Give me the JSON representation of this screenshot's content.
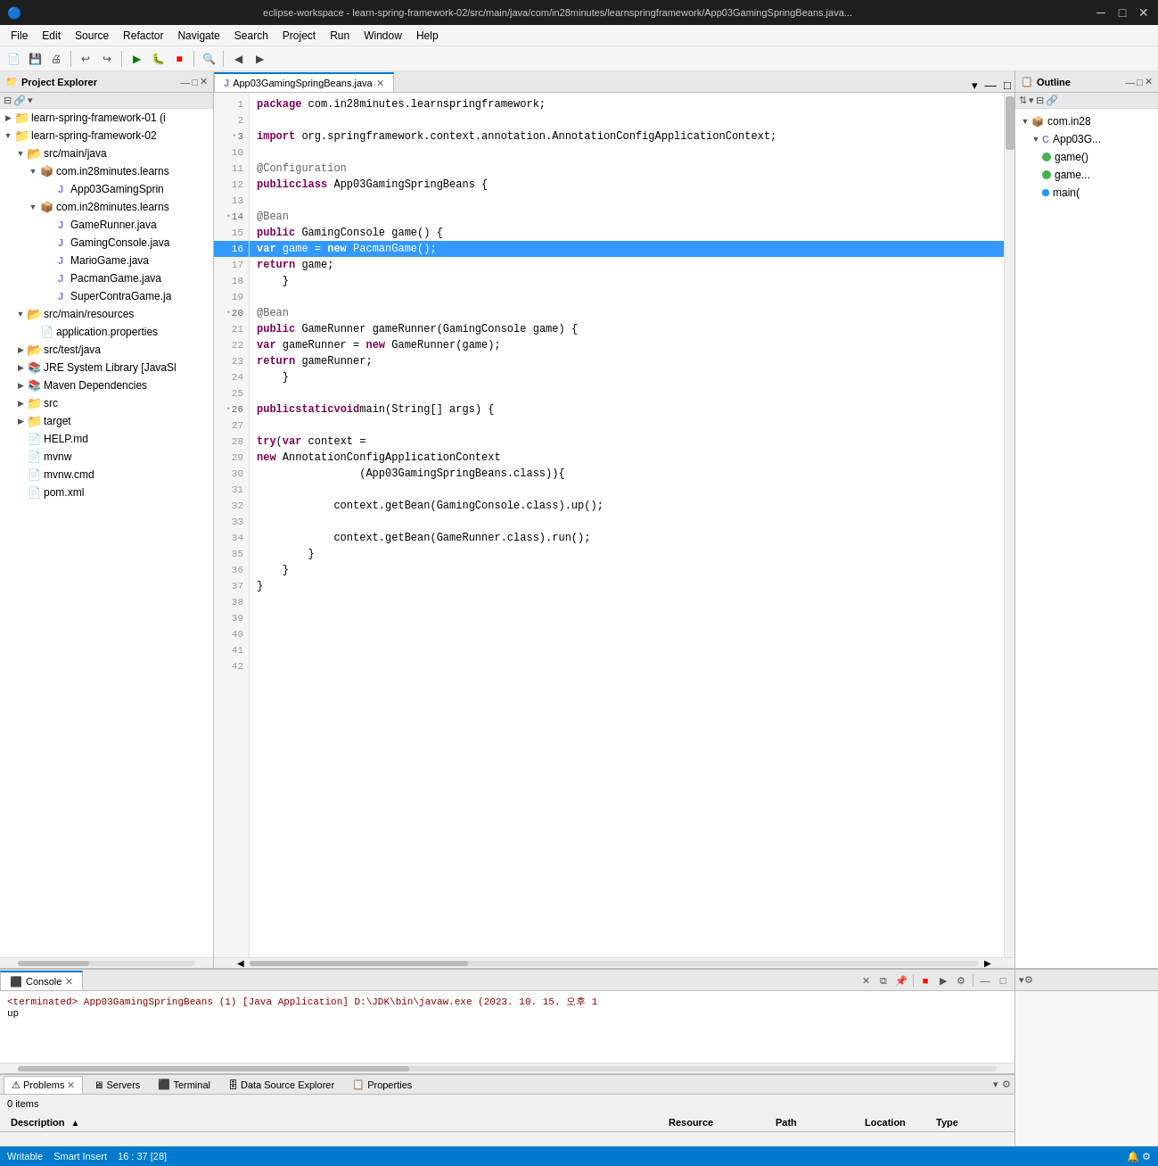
{
  "window": {
    "title": "eclipse-workspace - learn-spring-framework-02/src/main/java/com/in28minutes/learnspringframework/App03GamingSpringBeans.java...",
    "icon": "eclipse-icon"
  },
  "menu": {
    "items": [
      "File",
      "Edit",
      "Source",
      "Refactor",
      "Navigate",
      "Search",
      "Project",
      "Run",
      "Window",
      "Help"
    ]
  },
  "project_explorer": {
    "title": "Project Explorer",
    "items": [
      {
        "label": "learn-spring-framework-01 (i",
        "level": 0,
        "type": "project",
        "expanded": true
      },
      {
        "label": "learn-spring-framework-02",
        "level": 0,
        "type": "project",
        "expanded": true
      },
      {
        "label": "src/main/java",
        "level": 1,
        "type": "src-folder",
        "expanded": true
      },
      {
        "label": "com.in28minutes.learns",
        "level": 2,
        "type": "package",
        "expanded": true
      },
      {
        "label": "App03GamingSprin",
        "level": 3,
        "type": "java",
        "expanded": false
      },
      {
        "label": "com.in28minutes.learns",
        "level": 2,
        "type": "package",
        "expanded": true
      },
      {
        "label": "GameRunner.java",
        "level": 3,
        "type": "java",
        "expanded": false
      },
      {
        "label": "GamingConsole.java",
        "level": 3,
        "type": "java",
        "expanded": false
      },
      {
        "label": "MarioGame.java",
        "level": 3,
        "type": "java",
        "expanded": false
      },
      {
        "label": "PacmanGame.java",
        "level": 3,
        "type": "java",
        "expanded": false
      },
      {
        "label": "SuperContraGame.ja",
        "level": 3,
        "type": "java",
        "expanded": false
      },
      {
        "label": "src/main/resources",
        "level": 1,
        "type": "src-folder",
        "expanded": true
      },
      {
        "label": "application.properties",
        "level": 2,
        "type": "file",
        "expanded": false
      },
      {
        "label": "src/test/java",
        "level": 1,
        "type": "src-folder",
        "expanded": false
      },
      {
        "label": "JRE System Library [JavaSI",
        "level": 1,
        "type": "lib",
        "expanded": false
      },
      {
        "label": "Maven Dependencies",
        "level": 1,
        "type": "lib",
        "expanded": false
      },
      {
        "label": "src",
        "level": 1,
        "type": "folder",
        "expanded": false
      },
      {
        "label": "target",
        "level": 1,
        "type": "folder",
        "expanded": false
      },
      {
        "label": "HELP.md",
        "level": 1,
        "type": "file",
        "expanded": false
      },
      {
        "label": "mvnw",
        "level": 1,
        "type": "file",
        "expanded": false
      },
      {
        "label": "mvnw.cmd",
        "level": 1,
        "type": "file",
        "expanded": false
      },
      {
        "label": "pom.xml",
        "level": 1,
        "type": "file",
        "expanded": false
      }
    ]
  },
  "editor": {
    "tab": "App03GamingSpringBeans.java",
    "lines": [
      {
        "num": 1,
        "marker": "",
        "content": "<span class='kw'>package</span> com.in28minutes.learnspringframework;"
      },
      {
        "num": 2,
        "marker": "",
        "content": ""
      },
      {
        "num": 3,
        "marker": "•",
        "content": "<span class='kw'>import</span> org.springframework.context.annotation.AnnotationConfigApplicationContext;"
      },
      {
        "num": 10,
        "marker": "",
        "content": ""
      },
      {
        "num": 11,
        "marker": "",
        "content": "<span class='annotation'>@Configuration</span>"
      },
      {
        "num": 12,
        "marker": "",
        "content": "<span class='kw'>public</span> <span class='kw'>class</span> App03GamingSpringBeans {"
      },
      {
        "num": 13,
        "marker": "",
        "content": ""
      },
      {
        "num": 14,
        "marker": "•",
        "content": "    <span class='annotation'>@Bean</span>"
      },
      {
        "num": 15,
        "marker": "",
        "content": "    <span class='kw'>public</span> GamingConsole game() {"
      },
      {
        "num": 16,
        "marker": "",
        "content": "        <span class='kw'>var</span> game = <span class='kw'>new</span> PacmanGame();",
        "highlighted": true
      },
      {
        "num": 17,
        "marker": "",
        "content": "        <span class='kw'>return</span> game;"
      },
      {
        "num": 18,
        "marker": "",
        "content": "    }"
      },
      {
        "num": 19,
        "marker": "",
        "content": ""
      },
      {
        "num": 20,
        "marker": "•",
        "content": "    <span class='annotation'>@Bean</span>"
      },
      {
        "num": 21,
        "marker": "",
        "content": "    <span class='kw'>public</span> GameRunner gameRunner(GamingConsole game) {"
      },
      {
        "num": 22,
        "marker": "",
        "content": "        <span class='kw'>var</span> gameRunner = <span class='kw'>new</span> GameRunner(game);"
      },
      {
        "num": 23,
        "marker": "",
        "content": "        <span class='kw'>return</span> gameRunner;"
      },
      {
        "num": 24,
        "marker": "",
        "content": "    }"
      },
      {
        "num": 25,
        "marker": "",
        "content": ""
      },
      {
        "num": 26,
        "marker": "•",
        "content": "    <span class='kw'>public</span> <span class='kw'>static</span> <span class='kw'>void</span> main(String[] args) {"
      },
      {
        "num": 27,
        "marker": "",
        "content": ""
      },
      {
        "num": 28,
        "marker": "",
        "content": "        <span class='kw'>try</span>(<span class='kw'>var</span> context ="
      },
      {
        "num": 29,
        "marker": "",
        "content": "                <span class='kw'>new</span> AnnotationConfigApplicationContext"
      },
      {
        "num": 30,
        "marker": "",
        "content": "                (App03GamingSpringBeans.class)){"
      },
      {
        "num": 31,
        "marker": "",
        "content": ""
      },
      {
        "num": 32,
        "marker": "",
        "content": "            context.getBean(GamingConsole.class).up();"
      },
      {
        "num": 33,
        "marker": "",
        "content": ""
      },
      {
        "num": 34,
        "marker": "",
        "content": "            context.getBean(GameRunner.class).run();"
      },
      {
        "num": 35,
        "marker": "",
        "content": "        }"
      },
      {
        "num": 36,
        "marker": "",
        "content": "    }"
      },
      {
        "num": 37,
        "marker": "",
        "content": "}"
      },
      {
        "num": 38,
        "marker": "",
        "content": ""
      },
      {
        "num": 39,
        "marker": "",
        "content": ""
      },
      {
        "num": 40,
        "marker": "",
        "content": ""
      },
      {
        "num": 41,
        "marker": "",
        "content": ""
      },
      {
        "num": 42,
        "marker": "",
        "content": ""
      }
    ]
  },
  "outline": {
    "title": "Outline",
    "items": [
      {
        "label": "com.in28",
        "level": 0,
        "type": "package"
      },
      {
        "label": "App03G...",
        "level": 1,
        "type": "class"
      },
      {
        "label": "game()",
        "level": 2,
        "type": "method-green"
      },
      {
        "label": "game...",
        "level": 2,
        "type": "method-green"
      },
      {
        "label": "main(",
        "level": 2,
        "type": "method-blue"
      }
    ]
  },
  "console": {
    "title": "Console",
    "content": "<terminated> App03GamingSpringBeans (1) [Java Application] D:\\JDK\\bin\\javaw.exe  (2023. 10. 15. 오후 1",
    "content2": "up"
  },
  "bottom_tabs": {
    "tabs": [
      "Problems",
      "Servers",
      "Terminal",
      "Data Source Explorer",
      "Properties"
    ],
    "active": "Problems"
  },
  "problems": {
    "count": "0 items",
    "columns": [
      "Description",
      "Resource",
      "Path",
      "Location",
      "Type"
    ]
  },
  "status_bar": {
    "writable": "Writable",
    "insert": "Smart Insert",
    "position": "16 : 37 [28]"
  },
  "colors": {
    "accent": "#0078d4",
    "highlight_line": "#3399ff",
    "keyword": "#7f0055",
    "annotation": "#646464",
    "title_bar_bg": "#1e1e1e"
  }
}
